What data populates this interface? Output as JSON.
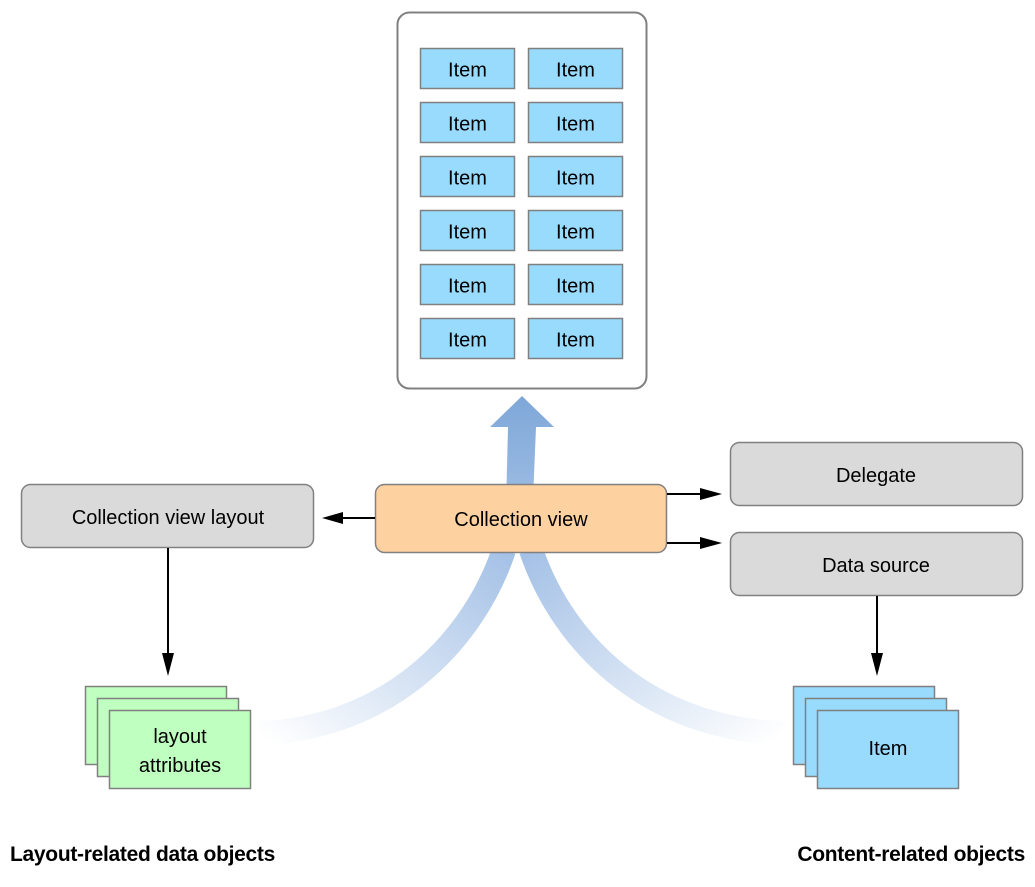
{
  "collection_container": {
    "items": [
      [
        "Item",
        "Item"
      ],
      [
        "Item",
        "Item"
      ],
      [
        "Item",
        "Item"
      ],
      [
        "Item",
        "Item"
      ],
      [
        "Item",
        "Item"
      ],
      [
        "Item",
        "Item"
      ]
    ]
  },
  "nodes": {
    "collection_view": "Collection view",
    "collection_view_layout": "Collection view layout",
    "delegate": "Delegate",
    "data_source": "Data source",
    "layout_attributes_line1": "layout",
    "layout_attributes_line2": "attributes",
    "content_item": "Item"
  },
  "captions": {
    "left": "Layout-related data objects",
    "right": "Content-related objects"
  },
  "colors": {
    "item_fill": "#99dbfd",
    "collection_view_fill": "#fed1a0",
    "gray_node_fill": "#dadada",
    "layout_attr_fill": "#bfffbf",
    "flow_arrow": "#7ea7d8",
    "border": "#808080"
  }
}
